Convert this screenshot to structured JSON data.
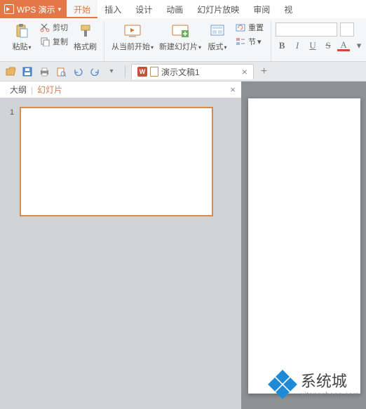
{
  "app": {
    "name": "WPS 演示"
  },
  "menu": {
    "items": [
      "开始",
      "插入",
      "设计",
      "动画",
      "幻灯片放映",
      "审阅",
      "视"
    ],
    "active_index": 0
  },
  "ribbon": {
    "clipboard": {
      "paste": "粘贴",
      "cut": "剪切",
      "copy": "复制",
      "format_painter": "格式刷"
    },
    "slides": {
      "from_current": "从当前开始",
      "new_slide": "新建幻灯片",
      "layout": "版式",
      "reset": "重置",
      "section": "节"
    },
    "font": {
      "bold": "B",
      "italic": "I",
      "underline": "U",
      "strike": "S",
      "color": "A"
    }
  },
  "qat": {
    "doc_title": "演示文稿1"
  },
  "side_panel": {
    "tabs": [
      "大纲",
      "幻灯片"
    ],
    "active_index": 1
  },
  "thumbnails": [
    {
      "number": "1"
    }
  ],
  "watermark": {
    "text": "系统城",
    "sub": "xitongcheng.com"
  }
}
